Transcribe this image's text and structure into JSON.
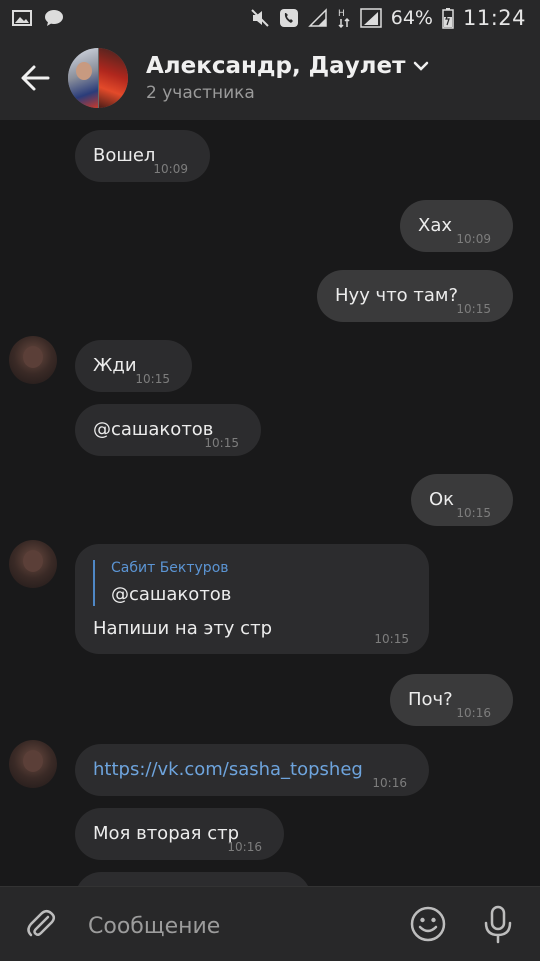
{
  "status_bar": {
    "battery": "64%",
    "time": "11:24",
    "icons": [
      "image-icon",
      "chat-icon",
      "mute-icon",
      "phone-icon",
      "signal-icon",
      "data-icon",
      "signal-icon",
      "battery-icon"
    ]
  },
  "header": {
    "title": "Александр, Даулет",
    "subtitle": "2 участника"
  },
  "messages": [
    {
      "text": "Вошел",
      "time": "10:09",
      "direction": "in"
    },
    {
      "text": "Хах",
      "time": "10:09",
      "direction": "out"
    },
    {
      "text": "Нуу что там?",
      "time": "10:15",
      "direction": "out"
    },
    {
      "text": "Жди",
      "time": "10:15",
      "direction": "in"
    },
    {
      "text": "@сашакотов",
      "time": "10:15",
      "direction": "in"
    },
    {
      "text": "Ок",
      "time": "10:15",
      "direction": "out"
    },
    {
      "reply_author": "Сабит Бектуров",
      "reply_text": "@сашакотов",
      "text": "Напиши на эту стр",
      "time": "10:15",
      "direction": "in"
    },
    {
      "text": "Поч?",
      "time": "10:16",
      "direction": "out"
    },
    {
      "text": "https://vk.com/sasha_topsheg",
      "time": "10:16",
      "direction": "in"
    },
    {
      "text": "Моя вторая стр",
      "time": "10:16",
      "direction": "in"
    }
  ],
  "composer": {
    "placeholder": "Сообщение"
  },
  "colors": {
    "background": "#19191a",
    "bars": "#282829",
    "bubble_in": "#2c2c2e",
    "bubble_out": "#3a3a3b",
    "link": "#6ea4dd"
  }
}
